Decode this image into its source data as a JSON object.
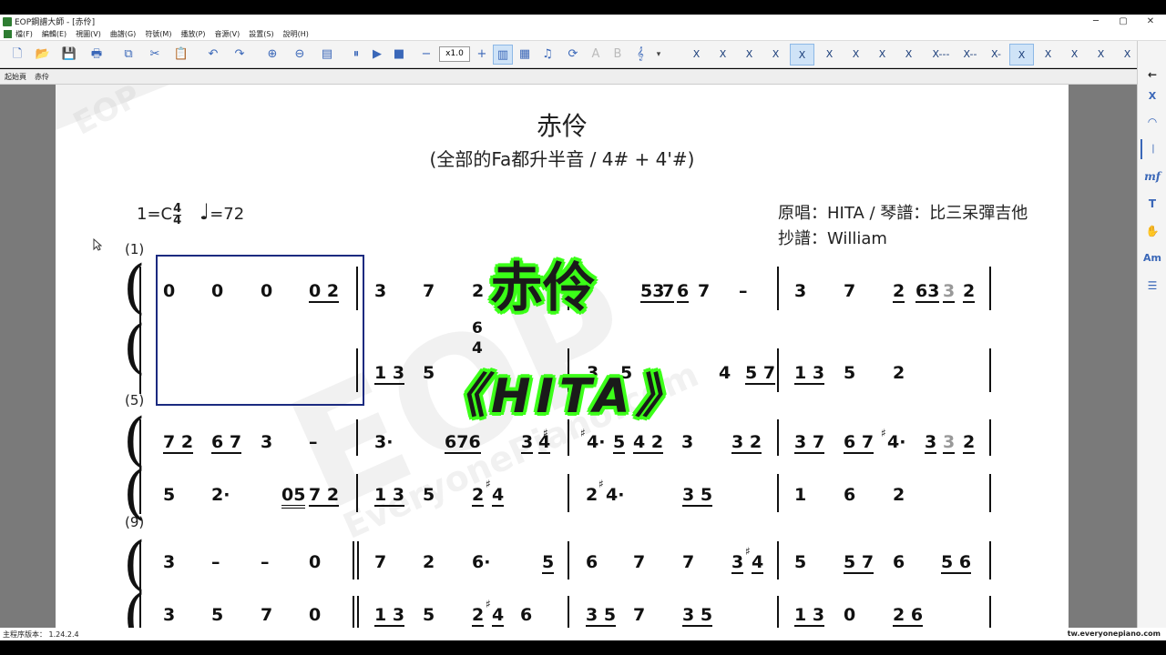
{
  "window": {
    "title": "EOP鋼譜大師 - [赤伶]",
    "controls": [
      "─",
      "▢",
      "✕"
    ]
  },
  "menu": [
    "檔(F)",
    "編輯(E)",
    "視圖(V)",
    "曲譜(G)",
    "符號(M)",
    "播放(P)",
    "音源(V)",
    "設置(S)",
    "說明(H)"
  ],
  "toolbar": {
    "tempo_value": "x1.0",
    "icons": [
      "new-icon",
      "open-icon",
      "save-icon",
      "print-icon",
      "copy-icon",
      "cut-icon",
      "paste-icon",
      "undo-icon",
      "redo-icon",
      "zoom-in-icon",
      "zoom-out-icon",
      "page-icon",
      "pause-icon",
      "play-icon",
      "stop-icon",
      "minus-icon",
      "plus-icon"
    ],
    "note_buttons": [
      "X",
      "X",
      "X",
      "X",
      "X",
      "X",
      "X",
      "X",
      "X",
      "X---",
      "X--",
      "X-",
      "X",
      "X",
      "X",
      "X",
      "X"
    ]
  },
  "tabs": [
    "起始頁",
    "赤伶"
  ],
  "score": {
    "title": "赤伶",
    "subtitle": "(全部的Fa都升半音 / 4# + 4'#)",
    "key": "1=C",
    "time_top": "4",
    "time_bottom": "4",
    "tempo": "=72",
    "credit_line1": "原唱：HITA / 琴譜：比三呆彈吉他",
    "credit_line2": "抄譜：William",
    "measure_numbers": [
      "(1)",
      "(5)",
      "(9)"
    ],
    "systems": [
      {
        "treble": [
          "0",
          "0",
          "0",
          "0 2",
          "3",
          "7",
          "2",
          "53",
          "7",
          "6",
          "7",
          "–",
          "3",
          "7",
          "2",
          "63",
          "3",
          "2"
        ],
        "chord_top": "6",
        "chord_bottom": "4",
        "bass": [
          "1 3",
          "5",
          "3",
          "5",
          "4",
          "5 7",
          "1 3",
          "5",
          "2"
        ]
      },
      {
        "treble": [
          "7 2",
          "6 7",
          "3",
          "–",
          "3·",
          "676",
          "3",
          "4",
          "4·",
          "5",
          "4 2",
          "3",
          "3 2",
          "3 7",
          "6 7",
          "4·",
          "3",
          "3",
          "2"
        ],
        "bass": [
          "5",
          "2·",
          "05",
          "7 2",
          "1 3",
          "5",
          "2",
          "4",
          "2",
          "4·",
          "3 5",
          "1",
          "6",
          "2"
        ]
      },
      {
        "treble": [
          "3",
          "–",
          "–",
          "0",
          "7",
          "2",
          "6·",
          "5",
          "6",
          "7",
          "7",
          "3",
          "4",
          "5",
          "5 7",
          "6",
          "5 6"
        ],
        "bass": [
          "3",
          "5",
          "7",
          "0",
          "1 3",
          "5",
          "2",
          "4",
          "6",
          "3 5",
          "7",
          "3 5",
          "1 3",
          "0",
          "2 6"
        ]
      }
    ]
  },
  "overlay": {
    "title": "赤伶",
    "artist": "《HITA》"
  },
  "watermark": {
    "logo": "EOP",
    "site": "EveryonePiano.com"
  },
  "status": {
    "version": "主程序版本： 1.24.2.4",
    "site": "tw.everyonepiano.com"
  },
  "colors": {
    "overlay_glow": "#3cff19",
    "selection": "#1b2a80",
    "toolbar_icon": "#3a67b8"
  }
}
